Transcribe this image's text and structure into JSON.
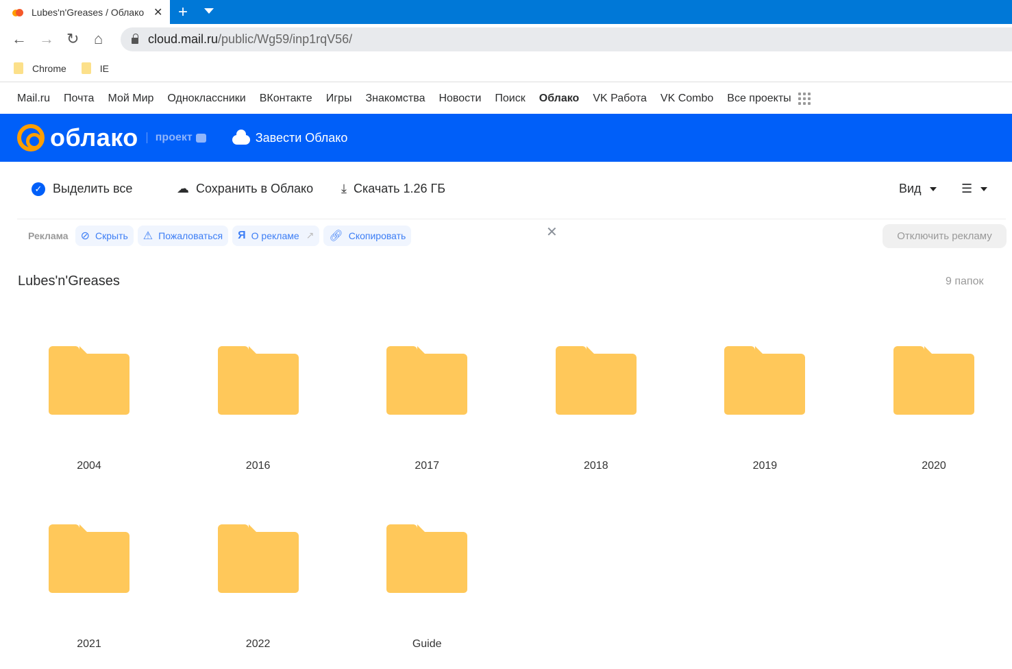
{
  "browser": {
    "tab_title": "Lubes'n'Greases / Облако",
    "url_host": "cloud.mail.ru",
    "url_path": "/public/Wg59/inp1rqV56/",
    "bookmarks": [
      {
        "label": "Chrome"
      },
      {
        "label": "IE"
      }
    ]
  },
  "portal_nav": {
    "items": [
      "Mail.ru",
      "Почта",
      "Мой Мир",
      "Одноклассники",
      "ВКонтакте",
      "Игры",
      "Знакомства",
      "Новости",
      "Поиск",
      "Облако",
      "VK Работа",
      "VK Combo",
      "Все проекты"
    ],
    "active": "Облако"
  },
  "header": {
    "logo": "облако",
    "project": "проект",
    "get_cloud": "Завести Облако"
  },
  "actions": {
    "select_all": "Выделить все",
    "save": "Сохранить в Облако",
    "download": "Скачать 1.26 ГБ",
    "view": "Вид"
  },
  "ads": {
    "label": "Реклама",
    "hide": "Скрыть",
    "complain": "Пожаловаться",
    "about": "О рекламе",
    "copy": "Скопировать",
    "disable": "Отключить рекламу"
  },
  "folder": {
    "title": "Lubes'n'Greases",
    "count": "9 папок"
  },
  "items": [
    {
      "name": "2004"
    },
    {
      "name": "2016"
    },
    {
      "name": "2017"
    },
    {
      "name": "2018"
    },
    {
      "name": "2019"
    },
    {
      "name": "2020"
    },
    {
      "name": "2021"
    },
    {
      "name": "2022"
    },
    {
      "name": "Guide"
    }
  ],
  "colors": {
    "brand_blue": "#005ff9",
    "tabbar": "#0078d7",
    "folder": "#ffc85a",
    "logo_orange": "#ff9e00"
  }
}
